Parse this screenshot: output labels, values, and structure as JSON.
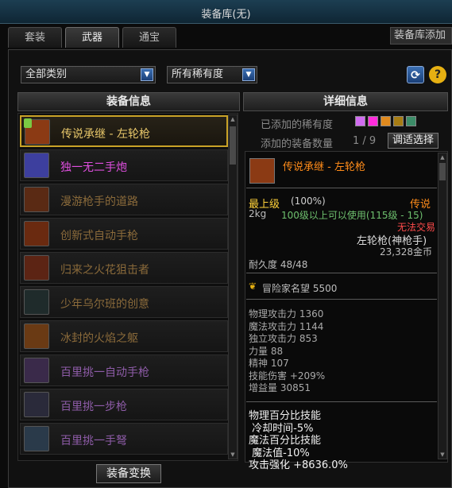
{
  "window": {
    "title": "装备库(无)",
    "peek_title": "装备库添加"
  },
  "tabs": [
    {
      "label": "套装"
    },
    {
      "label": "武器"
    },
    {
      "label": "通宝"
    }
  ],
  "filters": {
    "category": "全部类别",
    "rarity": "所有稀有度"
  },
  "headers": {
    "list": "装备信息",
    "detail": "详细信息"
  },
  "items": [
    {
      "name": "传说承继 - 左轮枪",
      "color": "#e8c76a",
      "icon_color": "#8b3a14"
    },
    {
      "name": "独一无二手炮",
      "color": "#e04fe0",
      "icon_color": "#3d3f9e"
    },
    {
      "name": "漫游枪手的道路",
      "color": "#8a6a3a",
      "icon_color": "#5a2a14"
    },
    {
      "name": "创新式自动手枪",
      "color": "#8a6a3a",
      "icon_color": "#6a2a10"
    },
    {
      "name": "归来之火花狙击者",
      "color": "#8a6a3a",
      "icon_color": "#5c2414"
    },
    {
      "name": "少年乌尔班的创意",
      "color": "#8a6a3a",
      "icon_color": "#1f2b2b"
    },
    {
      "name": "冰封的火焰之躯",
      "color": "#8a6a3a",
      "icon_color": "#6a3a14"
    },
    {
      "name": "百里挑一自动手枪",
      "color": "#8e5ca8",
      "icon_color": "#3a2a4a"
    },
    {
      "name": "百里挑一步枪",
      "color": "#8e5ca8",
      "icon_color": "#2a2a3a"
    },
    {
      "name": "百里挑一手弩",
      "color": "#8e5ca8",
      "icon_color": "#2a3a4a"
    }
  ],
  "convert_button": "装备变换",
  "detail": {
    "added_rarity_label": "已添加的稀有度",
    "added_count_label": "添加的装备数量",
    "added_count": "1 / 9",
    "select_button": "调适选择",
    "swatch_colors": [
      "#d06cf0",
      "#ff2cdc",
      "#e08a1e",
      "#a67c14",
      "#3c8c68"
    ],
    "item_name": "传说承继 - 左轮枪",
    "grade": "最上级",
    "grade_pct": "(100%)",
    "rarity": "传说",
    "weight": "2kg",
    "level_req": "100级以上可以使用(115级 - 15)",
    "trade": "无法交易",
    "type": "左轮枪(神枪手)",
    "price": "23,328金币",
    "durability": "耐久度 48/48",
    "reputation": "冒险家名望 5500",
    "stats": [
      "物理攻击力 1360",
      "魔法攻击力 1144",
      "独立攻击力 853",
      "力量 88",
      "精神 107",
      "技能伤害 +209%",
      "增益量 30851"
    ],
    "bonus": [
      "物理百分比技能",
      " 冷却时间-5%",
      "魔法百分比技能",
      " 魔法值-10%",
      "攻击强化 +8636.0%"
    ]
  },
  "colors": {
    "gold": "#ffd23a",
    "legend": "#ff8c1a",
    "green": "#6ec06e",
    "red": "#ff4b4b"
  }
}
